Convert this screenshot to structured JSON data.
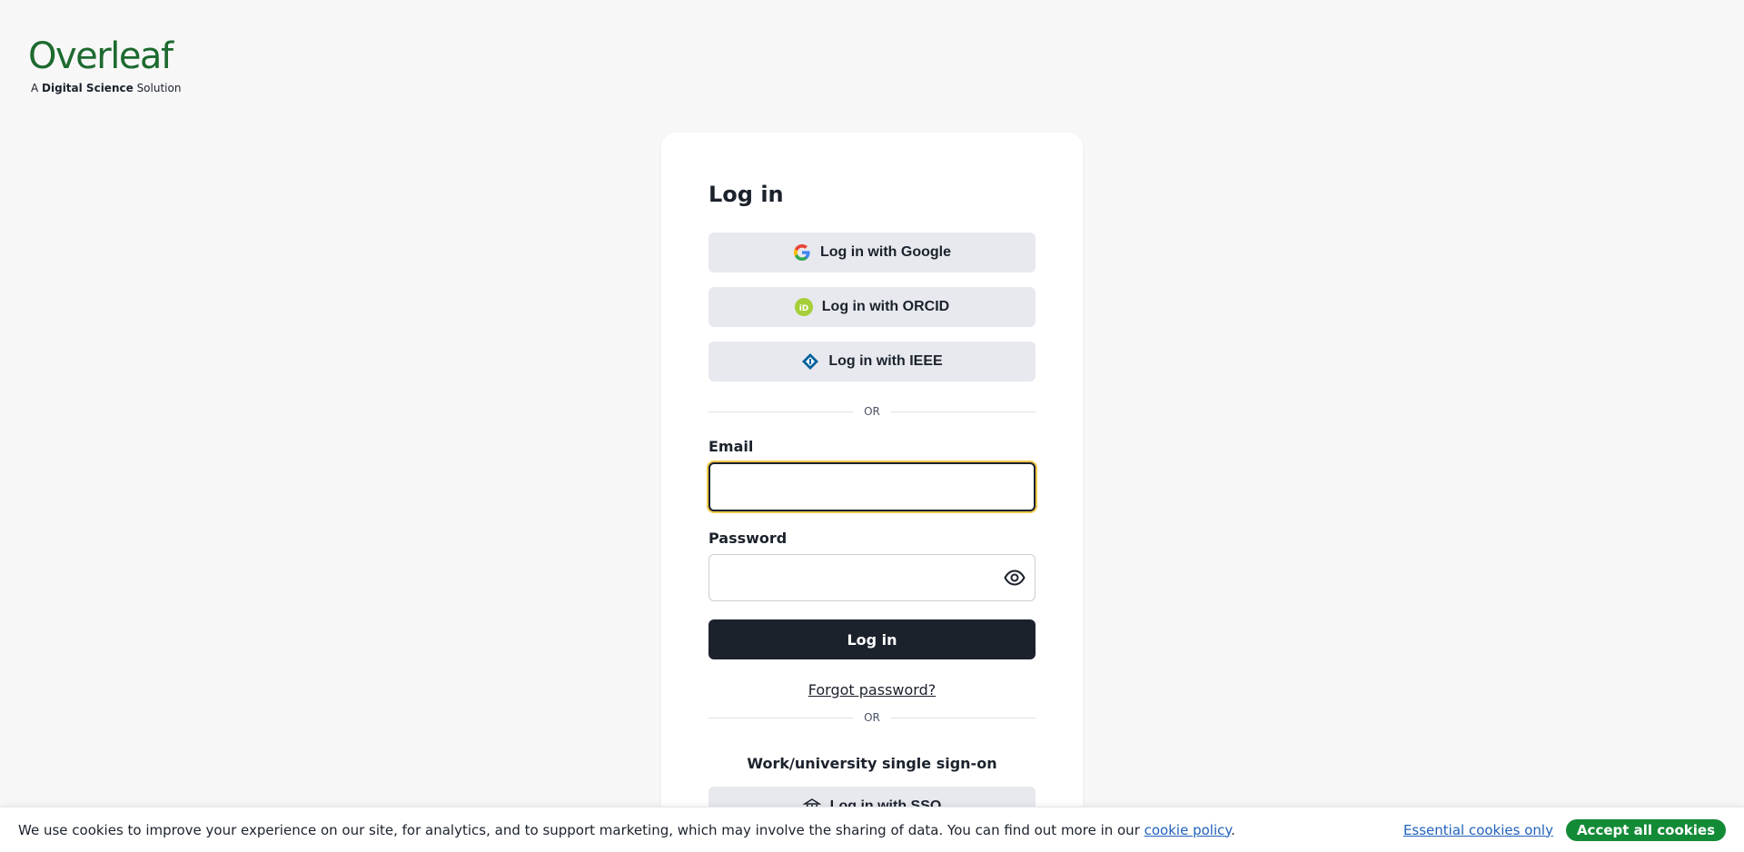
{
  "logo": {
    "word": "Overleaf",
    "sub_prefix": "A ",
    "sub_bold": "Digital Science",
    "sub_suffix": " Solution"
  },
  "card": {
    "title": "Log in",
    "google_label": "Log in with Google",
    "orcid_label": "Log in with ORCID",
    "ieee_label": "Log in with IEEE",
    "divider_1": "OR",
    "email_label": "Email",
    "email_value": "",
    "password_label": "Password",
    "password_value": "",
    "login_label": "Log in",
    "forgot_label": "Forgot password?",
    "divider_2": "OR",
    "sso_heading": "Work/university single sign-on",
    "sso_label": "Log in with SSO"
  },
  "cookie_bar": {
    "text": "We use cookies to improve your experience on our site, for analytics, and to support marketing, which may involve the sharing of data. You can find out more in our ",
    "policy_link": "cookie policy",
    "text_end": ".",
    "essential_label": "Essential cookies only",
    "accept_label": "Accept all cookies"
  },
  "colors": {
    "brand_green": "#1d6a2f",
    "accent_green": "#138a36",
    "link_blue": "#2262bd",
    "focus_yellow": "#f2c94c",
    "dark": "#1b222c"
  },
  "icons": {
    "google": "google-icon",
    "orcid": "orcid-icon",
    "ieee": "ieee-icon",
    "eye": "eye-icon",
    "institution": "institution-icon"
  }
}
